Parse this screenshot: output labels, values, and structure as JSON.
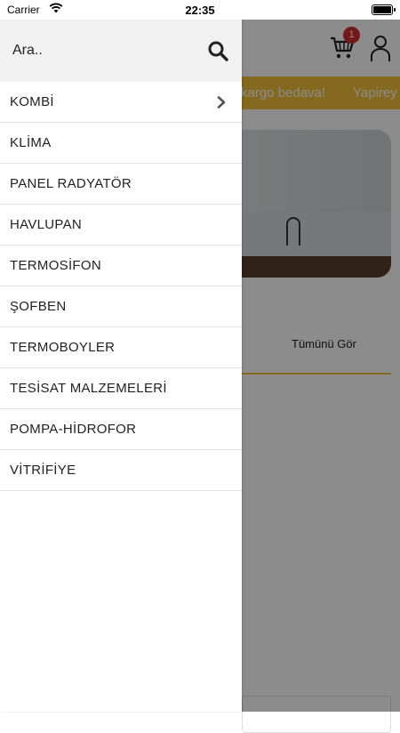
{
  "status_bar": {
    "carrier": "Carrier",
    "time": "22:35"
  },
  "app": {
    "cart_count": "1",
    "promo": [
      "kargo bedava!",
      "Yapirey"
    ],
    "see_all": "Tümünü Gör"
  },
  "drawer": {
    "search": {
      "placeholder": "Ara.."
    },
    "items": [
      {
        "label": "KOMBİ",
        "has_chevron": true
      },
      {
        "label": "KLİMA"
      },
      {
        "label": "PANEL RADYATÖR"
      },
      {
        "label": "HAVLUPAN"
      },
      {
        "label": "TERMOSİFON"
      },
      {
        "label": "ŞOFBEN"
      },
      {
        "label": "TERMOBOYLER"
      },
      {
        "label": "TESİSAT MALZEMELERİ"
      },
      {
        "label": "POMPA-HİDROFOR"
      },
      {
        "label": "VİTRİFİYE"
      }
    ]
  },
  "colors": {
    "accent": "#f2c038",
    "badge": "#d32f2f",
    "overlay": "rgba(0,0,0,0.45)"
  }
}
